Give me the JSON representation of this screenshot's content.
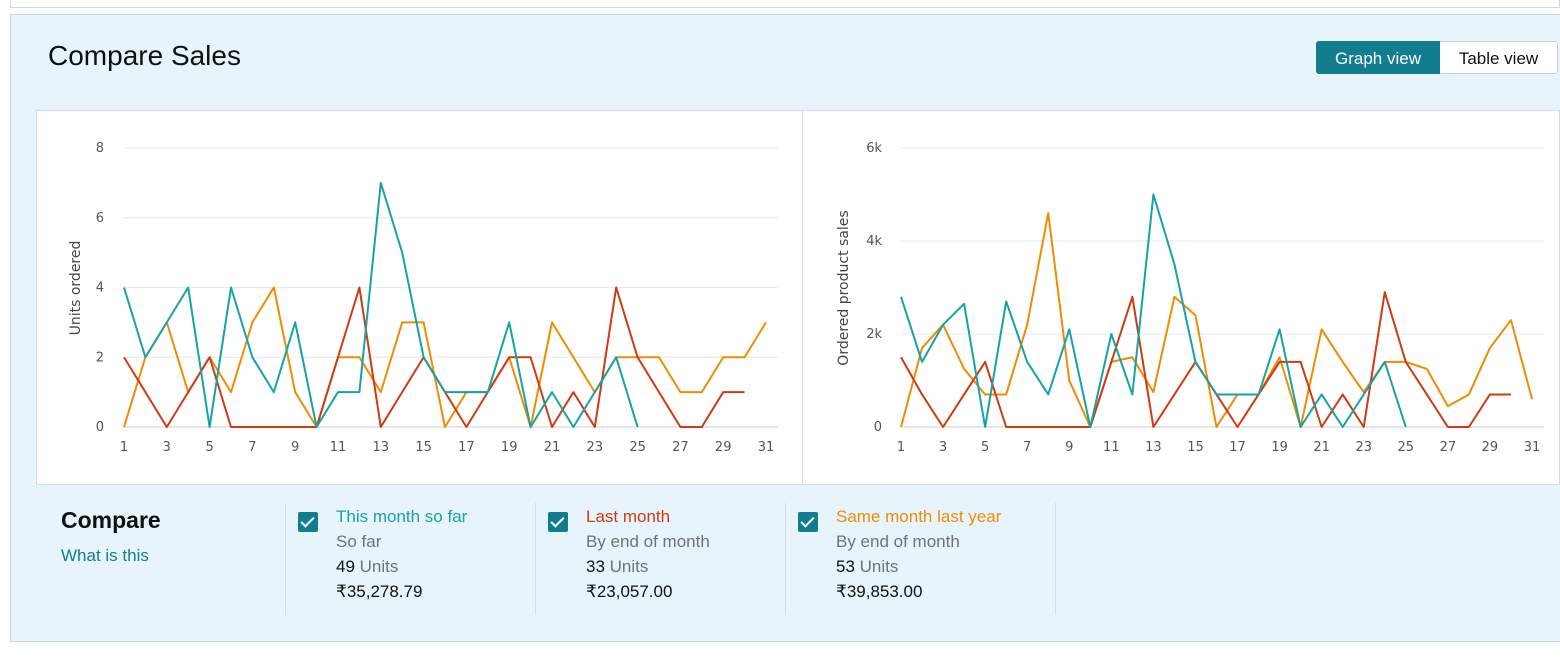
{
  "page": {
    "title": "Compare Sales"
  },
  "view_toggle": {
    "graph_label": "Graph view",
    "table_label": "Table view",
    "selected": "Graph view"
  },
  "colors": {
    "this_month": "#17a2a8",
    "last_month": "#cf3a12",
    "last_year": "#f08c00",
    "accent": "#127d8f"
  },
  "chart_data": [
    {
      "type": "line",
      "ylabel": "Units ordered",
      "xlabel": "",
      "ylim": [
        0,
        8
      ],
      "y_ticks": [
        "0",
        "2",
        "4",
        "6",
        "8"
      ],
      "x_ticks": [
        "1",
        "3",
        "5",
        "7",
        "9",
        "11",
        "13",
        "15",
        "17",
        "19",
        "21",
        "23",
        "25",
        "27",
        "29",
        "31"
      ],
      "x": [
        1,
        2,
        3,
        4,
        5,
        6,
        7,
        8,
        9,
        10,
        11,
        12,
        13,
        14,
        15,
        16,
        17,
        18,
        19,
        20,
        21,
        22,
        23,
        24,
        25,
        26,
        27,
        28,
        29,
        30,
        31
      ],
      "grid": true,
      "series": [
        {
          "name": "This month so far",
          "color_key": "this_month",
          "values": [
            4,
            2,
            3,
            4,
            0,
            4,
            2,
            1,
            3,
            0,
            1,
            1,
            7,
            5,
            2,
            1,
            1,
            1,
            3,
            0,
            1,
            0,
            1,
            2,
            0
          ]
        },
        {
          "name": "Last month",
          "color_key": "last_month",
          "values": [
            2,
            1,
            0,
            1,
            2,
            0,
            0,
            0,
            0,
            0,
            2,
            4,
            0,
            1,
            2,
            1,
            0,
            1,
            2,
            2,
            0,
            1,
            0,
            4,
            2,
            1,
            0,
            0,
            1,
            1
          ]
        },
        {
          "name": "Same month last year",
          "color_key": "last_year",
          "values": [
            0,
            2,
            3,
            1,
            2,
            1,
            3,
            4,
            1,
            0,
            2,
            2,
            1,
            3,
            3,
            0,
            1,
            1,
            2,
            0,
            3,
            2,
            1,
            2,
            2,
            2,
            1,
            1,
            2,
            2,
            3
          ]
        }
      ]
    },
    {
      "type": "line",
      "ylabel": "Ordered product sales",
      "xlabel": "",
      "ylim": [
        0,
        6000
      ],
      "y_ticks": [
        "0",
        "2k",
        "4k",
        "6k"
      ],
      "x_ticks": [
        "1",
        "3",
        "5",
        "7",
        "9",
        "11",
        "13",
        "15",
        "17",
        "19",
        "21",
        "23",
        "25",
        "27",
        "29",
        "31"
      ],
      "x": [
        1,
        2,
        3,
        4,
        5,
        6,
        7,
        8,
        9,
        10,
        11,
        12,
        13,
        14,
        15,
        16,
        17,
        18,
        19,
        20,
        21,
        22,
        23,
        24,
        25,
        26,
        27,
        28,
        29,
        30,
        31
      ],
      "grid": true,
      "series": [
        {
          "name": "This month so far",
          "color_key": "this_month",
          "values": [
            2800,
            1400,
            2200,
            2650,
            0,
            2700,
            1400,
            700,
            2100,
            0,
            2000,
            700,
            5000,
            3500,
            1400,
            700,
            700,
            700,
            2100,
            0,
            700,
            0,
            700,
            1400,
            0
          ]
        },
        {
          "name": "Last month",
          "color_key": "last_month",
          "values": [
            1500,
            700,
            0,
            700,
            1400,
            0,
            0,
            0,
            0,
            0,
            1400,
            2800,
            0,
            700,
            1400,
            700,
            0,
            700,
            1400,
            1400,
            0,
            700,
            0,
            2900,
            1400,
            700,
            0,
            0,
            700,
            700
          ]
        },
        {
          "name": "Same month last year",
          "color_key": "last_year",
          "values": [
            0,
            1700,
            2200,
            1250,
            700,
            700,
            2200,
            4600,
            1000,
            0,
            1400,
            1500,
            750,
            2800,
            2400,
            0,
            700,
            700,
            1500,
            0,
            2100,
            1400,
            750,
            1400,
            1400,
            1250,
            450,
            700,
            1700,
            2300,
            600
          ]
        }
      ]
    }
  ],
  "compare": {
    "heading": "Compare",
    "help_link": "What is this",
    "items": [
      {
        "label": "This month so far",
        "sub": "So far",
        "units_value": "49",
        "units_label": " Units",
        "amount": "₹35,278.79",
        "color_key": "this_month",
        "checked": true
      },
      {
        "label": "Last month",
        "sub": "By end of month",
        "units_value": "33",
        "units_label": " Units",
        "amount": "₹23,057.00",
        "color_key": "last_month",
        "checked": true
      },
      {
        "label": "Same month last year",
        "sub": "By end of month",
        "units_value": "53",
        "units_label": " Units",
        "amount": "₹39,853.00",
        "color_key": "last_year",
        "checked": true
      }
    ]
  }
}
